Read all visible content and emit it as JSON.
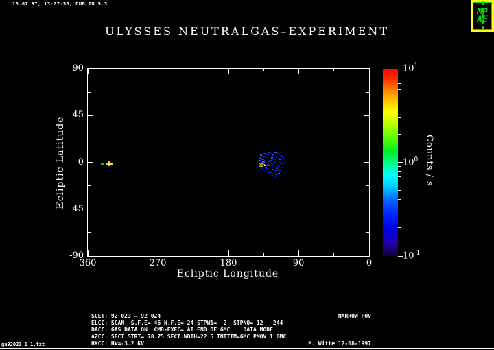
{
  "header": {
    "timestamp": "18.07.97, 13:27:50, DUBLIN 5.3"
  },
  "logo": {
    "line1": "MP",
    "line2": "AE",
    "fg": "#00dd00",
    "bg": "#ffff00"
  },
  "title": "ULYSSES NEUTRALGAS–EXPERIMENT",
  "chart_data": {
    "type": "scatter",
    "title": "ULYSSES NEUTRALGAS–EXPERIMENT",
    "xlabel": "Ecliptic Longitude",
    "ylabel": "Ecliptic Latitude",
    "xlim": [
      360,
      0
    ],
    "ylim": [
      -90,
      90
    ],
    "x_ticks": [
      360,
      270,
      180,
      90,
      0
    ],
    "x_tick_labels": [
      "360",
      "270",
      "180",
      "90",
      "0"
    ],
    "x_minor_ticks": [
      315,
      225,
      135,
      45
    ],
    "y_ticks": [
      90,
      45,
      0,
      -45,
      -90
    ],
    "y_tick_labels": [
      "90",
      "45",
      "0",
      "-45",
      "-90"
    ],
    "y_minor_ticks": [
      67.5,
      22.5,
      -22.5,
      -67.5
    ],
    "grid": false,
    "background": "#000000",
    "colorbar": {
      "label": "Counts / s",
      "scale": "log",
      "range": [
        0.1,
        10
      ],
      "ticks": [
        {
          "base": "10",
          "exp": "1",
          "value": 10
        },
        {
          "base": "10",
          "exp": "0",
          "value": 1
        },
        {
          "base": "10",
          "exp": "-1",
          "value": 0.1
        }
      ]
    },
    "features": [
      {
        "name": "green-marker",
        "lon": 343,
        "lat": -1,
        "color": "#00c832"
      },
      {
        "name": "yellow-star-marker",
        "lon": 332,
        "lat": -2,
        "color": "#f5d800"
      },
      {
        "name": "neutral-gas-cluster",
        "lon_range": [
          143,
          108
        ],
        "lat_range": [
          11,
          -14
        ],
        "peak": {
          "lon": 137,
          "lat": -3,
          "counts_per_s": 10
        },
        "description": "scattered blue dashes (~0.1-0.3 counts/s) with red/yellow/white peak"
      }
    ],
    "render": {
      "palette": [
        "#000088",
        "#0013c4",
        "#1b35f2",
        "#3a57ff",
        "#0726e0",
        "#5577ff"
      ],
      "dashes": [
        [
          390,
          221,
          3,
          2,
          2
        ],
        [
          399,
          221,
          4,
          2,
          3
        ],
        [
          408,
          222,
          3,
          1,
          0
        ],
        [
          384,
          223,
          4,
          2,
          2
        ],
        [
          394,
          223,
          3,
          1,
          1
        ],
        [
          404,
          223,
          3,
          2,
          4
        ],
        [
          411,
          224,
          2,
          1,
          0
        ],
        [
          379,
          225,
          3,
          2,
          3
        ],
        [
          387,
          225,
          5,
          1,
          1
        ],
        [
          397,
          225,
          3,
          2,
          2
        ],
        [
          407,
          226,
          4,
          1,
          1
        ],
        [
          376,
          227,
          4,
          1,
          1
        ],
        [
          383,
          227,
          3,
          2,
          4
        ],
        [
          391,
          227,
          4,
          1,
          3
        ],
        [
          401,
          227,
          3,
          2,
          1
        ],
        [
          409,
          228,
          3,
          1,
          2
        ],
        [
          414,
          228,
          2,
          1,
          0
        ],
        [
          378,
          229,
          3,
          2,
          2
        ],
        [
          386,
          229,
          4,
          1,
          1
        ],
        [
          395,
          229,
          3,
          2,
          3
        ],
        [
          403,
          230,
          4,
          1,
          1
        ],
        [
          411,
          230,
          3,
          1,
          4
        ],
        [
          374,
          231,
          3,
          1,
          1
        ],
        [
          381,
          231,
          4,
          2,
          2
        ],
        [
          390,
          231,
          3,
          1,
          4
        ],
        [
          398,
          231,
          4,
          2,
          1
        ],
        [
          406,
          232,
          3,
          1,
          3
        ],
        [
          413,
          232,
          3,
          1,
          0
        ],
        [
          377,
          233,
          4,
          2,
          3
        ],
        [
          385,
          233,
          3,
          1,
          1
        ],
        [
          393,
          233,
          4,
          2,
          2
        ],
        [
          402,
          234,
          3,
          1,
          1
        ],
        [
          410,
          234,
          4,
          1,
          4
        ],
        [
          375,
          235,
          3,
          1,
          1
        ],
        [
          382,
          235,
          4,
          2,
          3
        ],
        [
          391,
          235,
          3,
          1,
          2
        ],
        [
          399,
          235,
          3,
          2,
          1
        ],
        [
          407,
          236,
          3,
          1,
          1
        ],
        [
          413,
          236,
          2,
          1,
          0
        ],
        [
          376,
          237,
          3,
          1,
          2
        ],
        [
          392,
          237,
          4,
          2,
          1
        ],
        [
          400,
          237,
          3,
          1,
          3
        ],
        [
          408,
          238,
          4,
          1,
          1
        ],
        [
          388,
          239,
          3,
          2,
          1
        ],
        [
          396,
          239,
          4,
          1,
          4
        ],
        [
          404,
          240,
          3,
          2,
          1
        ],
        [
          411,
          240,
          3,
          1,
          2
        ],
        [
          389,
          241,
          4,
          1,
          3
        ],
        [
          397,
          242,
          3,
          2,
          1
        ],
        [
          405,
          242,
          3,
          1,
          1
        ],
        [
          412,
          242,
          2,
          1,
          0
        ],
        [
          378,
          243,
          3,
          1,
          1
        ],
        [
          386,
          243,
          3,
          2,
          2
        ],
        [
          394,
          243,
          4,
          1,
          1
        ],
        [
          402,
          244,
          3,
          2,
          4
        ],
        [
          409,
          244,
          3,
          1,
          1
        ],
        [
          380,
          245,
          3,
          1,
          4
        ],
        [
          388,
          245,
          4,
          2,
          1
        ],
        [
          396,
          246,
          3,
          1,
          2
        ],
        [
          404,
          246,
          3,
          1,
          1
        ],
        [
          383,
          247,
          3,
          2,
          1
        ],
        [
          391,
          247,
          3,
          1,
          3
        ],
        [
          399,
          248,
          4,
          1,
          1
        ],
        [
          407,
          248,
          3,
          1,
          2
        ],
        [
          386,
          249,
          3,
          1,
          1
        ],
        [
          394,
          250,
          3,
          2,
          4
        ],
        [
          402,
          250,
          3,
          1,
          1
        ],
        [
          390,
          251,
          3,
          1,
          2
        ],
        [
          397,
          252,
          4,
          1,
          1
        ],
        [
          405,
          252,
          3,
          1,
          3
        ],
        [
          393,
          253,
          3,
          1,
          1
        ],
        [
          401,
          254,
          3,
          1,
          2
        ],
        [
          397,
          255,
          3,
          1,
          1
        ],
        [
          404,
          256,
          2,
          1,
          4
        ],
        [
          400,
          257,
          2,
          1,
          1
        ]
      ],
      "hotspot": [
        [
          378,
          237,
          2,
          2,
          "#22aa22"
        ],
        [
          380,
          237,
          3,
          2,
          "#ffcc00"
        ],
        [
          379,
          239,
          2,
          3,
          "#ffe000"
        ],
        [
          381,
          239,
          3,
          3,
          "#ff2200"
        ],
        [
          384,
          239,
          2,
          2,
          "#ff8800"
        ],
        [
          385,
          240,
          3,
          2,
          "#ffffff"
        ],
        [
          378,
          241,
          2,
          2,
          "#00bb44"
        ],
        [
          381,
          242,
          3,
          2,
          "#9ccf11"
        ]
      ],
      "green_dot": [
        147,
        237,
        4,
        3,
        "#00c832"
      ],
      "star_parts": [
        [
          154,
          237,
          11,
          3,
          "#f5d800"
        ],
        [
          158,
          235,
          3,
          7,
          "#f5d800"
        ],
        [
          157,
          237,
          5,
          3,
          "#fff060"
        ]
      ]
    }
  },
  "footer": {
    "lines": [
      {
        "left": "SCET: 92 023 – 92 024",
        "right": "NARROW FOV"
      },
      {
        "left": "ELCC: SCAN  S.F.E= 46 N.F.E= 24 STPW1=  2  STPNO= 12   244",
        "right": ""
      },
      {
        "left": "DACC: GAS DATA ON  CMD-EXEC= AT END OF GMC    DATA MODE",
        "right": ""
      },
      {
        "left": "AZCC: SECT.STRT= 78.75 SECT.WDTH=22.5 INTTIM=GMC PMOV 1 GMC",
        "right": ""
      },
      {
        "left": "HKCC: HV=-3.2 KV",
        "right": "M. Witte 12-08-1997"
      }
    ]
  },
  "corner_file": "ga92023_1_1.txt"
}
